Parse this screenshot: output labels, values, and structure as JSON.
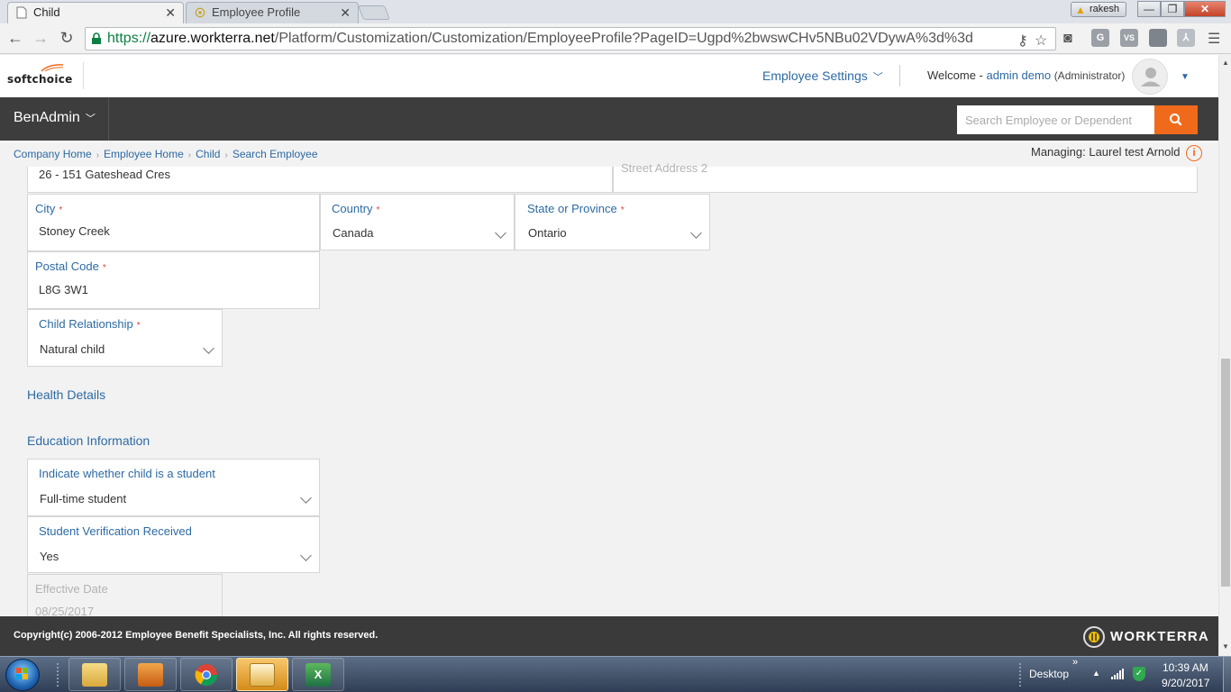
{
  "browser": {
    "tabs": [
      {
        "title": "Child",
        "active": true
      },
      {
        "title": "Employee Profile",
        "active": false
      }
    ],
    "profile_name": "rakesh",
    "url": {
      "protocol": "https://",
      "host": "azure.workterra.net",
      "path": "/Platform/Customization/Customization/EmployeeProfile?PageID=Ugpd%2bwswCHv5NBu02VDywA%3d%3d"
    },
    "extensions": [
      "G",
      "VS"
    ]
  },
  "header": {
    "logo_text": "softchoice",
    "employee_settings_label": "Employee Settings",
    "welcome_prefix": "Welcome -",
    "user_name": "admin demo",
    "user_role": "(Administrator)"
  },
  "navbar": {
    "brand": "BenAdmin",
    "search_placeholder": "Search Employee or Dependent",
    "accent_color": "#f06a1b"
  },
  "breadcrumb": [
    "Company Home",
    "Employee Home",
    "Child",
    "Search Employee"
  ],
  "managing": {
    "label": "Managing:",
    "name": "Laurel test Arnold"
  },
  "form": {
    "street_address_1_value": "26 - 151 Gateshead Cres",
    "street_address_2_label": "Street Address 2",
    "city": {
      "label": "City",
      "value": "Stoney Creek",
      "required": true
    },
    "country": {
      "label": "Country",
      "value": "Canada",
      "required": true
    },
    "state": {
      "label": "State or Province",
      "value": "Ontario",
      "required": true
    },
    "postal_code": {
      "label": "Postal Code",
      "value": "L8G 3W1",
      "required": true
    },
    "child_relationship": {
      "label": "Child Relationship",
      "value": "Natural child",
      "required": true
    },
    "health_section_title": "Health Details",
    "education_section_title": "Education Information",
    "student_status": {
      "label": "Indicate whether child is a student",
      "value": "Full-time student"
    },
    "student_verification": {
      "label": "Student Verification Received",
      "value": "Yes"
    },
    "effective_date": {
      "label": "Effective Date",
      "value": "08/25/2017"
    }
  },
  "footer": {
    "copyright": "Copyright(c) 2006-2012 Employee Benefit Specialists, Inc. All rights reserved.",
    "brand": "WORKTERRA"
  },
  "taskbar": {
    "desktop_label": "Desktop",
    "time": "10:39 AM",
    "date": "9/20/2017"
  }
}
